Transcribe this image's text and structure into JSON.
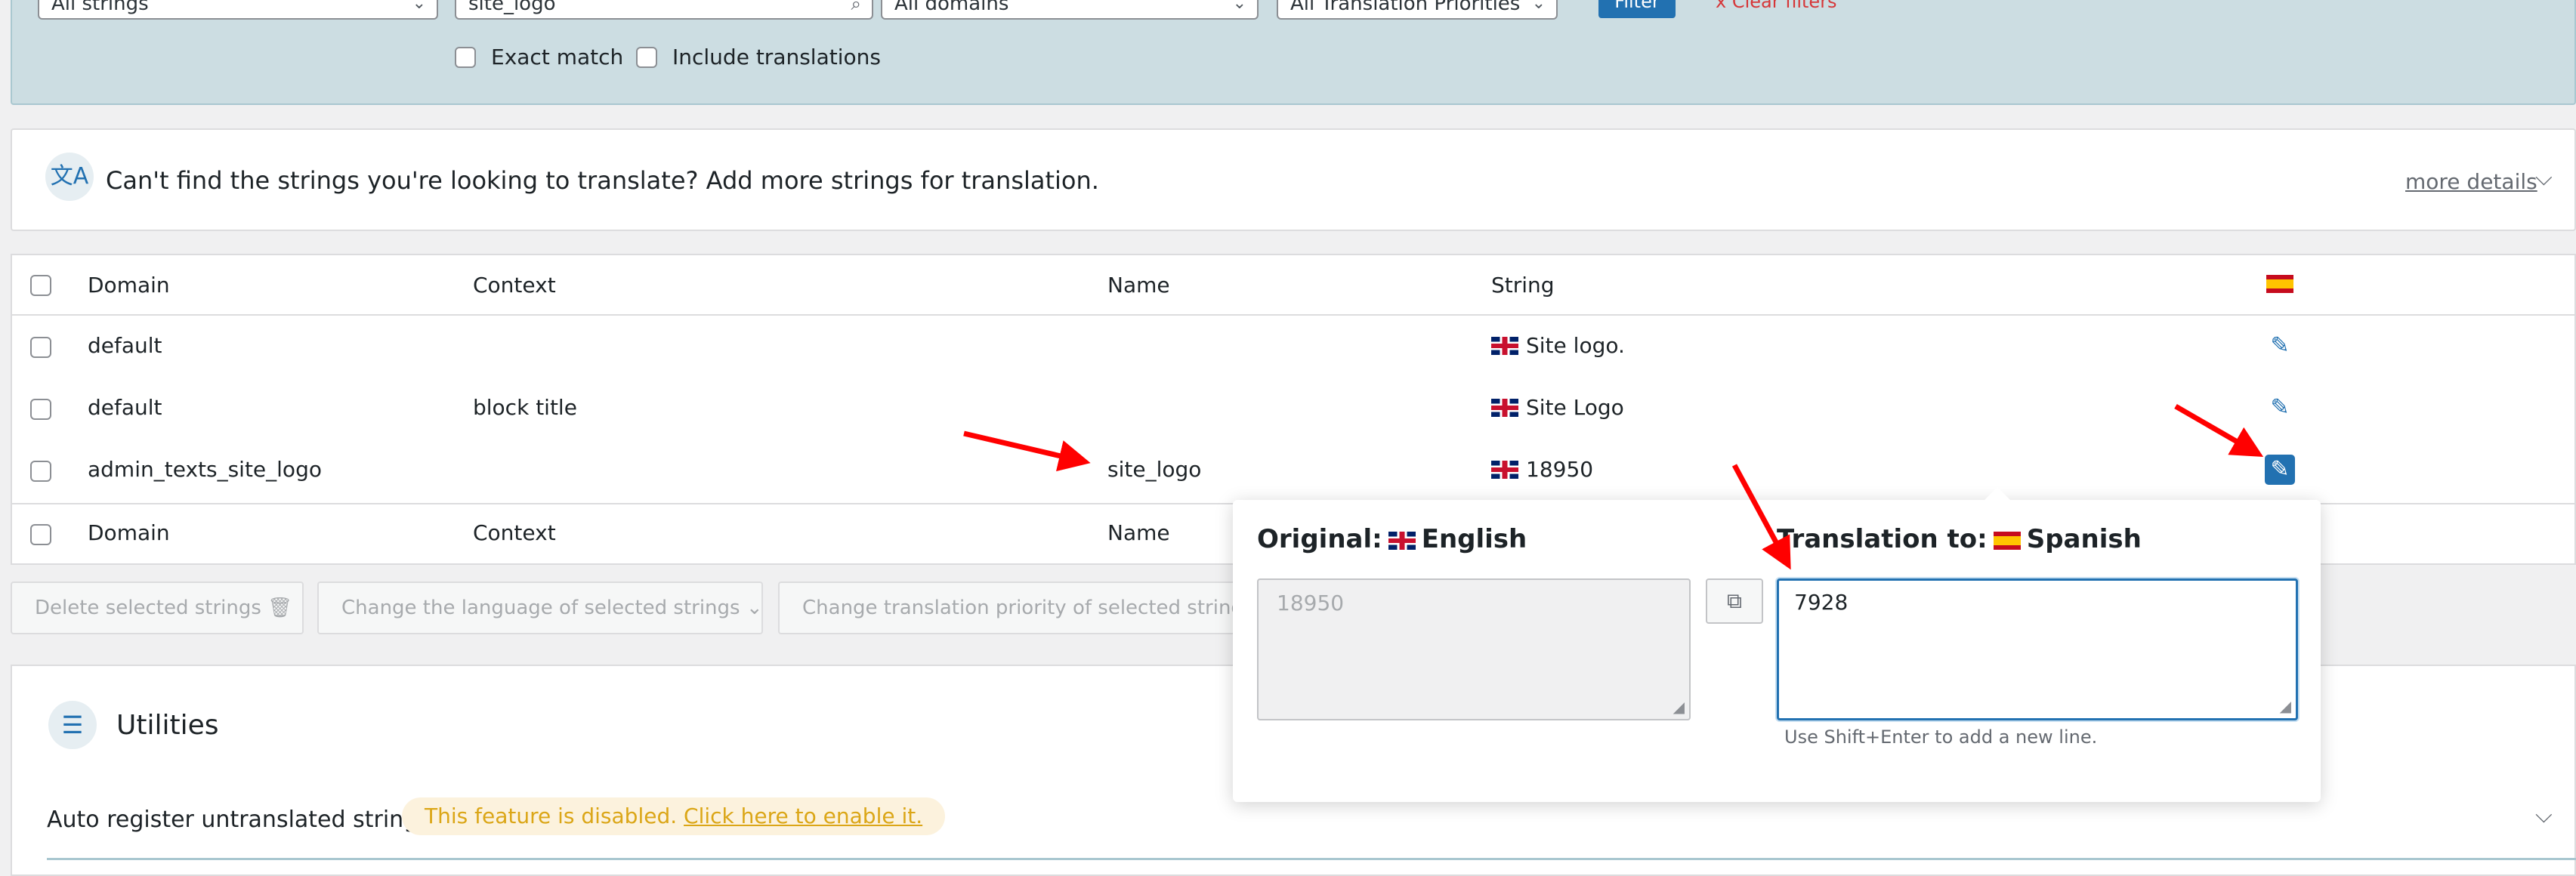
{
  "filters": {
    "strings_select": "All strings",
    "search_value": "site_logo",
    "domains_select": "All domains",
    "priorities_select": "All Translation Priorities",
    "filter_button": "Filter",
    "clear_filters": "x Clear filters",
    "exact_match": "Exact match",
    "include_translations": "Include translations"
  },
  "notice": {
    "text": "Can't find the strings you're looking to translate? Add more strings for translation.",
    "more_details": "more details"
  },
  "table": {
    "headers": {
      "domain": "Domain",
      "context": "Context",
      "name": "Name",
      "string": "String"
    },
    "rows": [
      {
        "domain": "default",
        "context": "",
        "name": "",
        "string": "Site logo."
      },
      {
        "domain": "default",
        "context": "block title",
        "name": "",
        "string": "Site Logo"
      },
      {
        "domain": "admin_texts_site_logo",
        "context": "",
        "name": "site_logo",
        "string": "18950"
      }
    ],
    "footers": {
      "domain": "Domain",
      "context": "Context",
      "name": "Name"
    }
  },
  "bulk_actions": {
    "delete": "Delete selected strings",
    "change_language": "Change the language of selected strings",
    "change_priority": "Change translation priority of selected strings"
  },
  "utilities": {
    "title": "Utilities",
    "auto_register_label": "Auto register untranslated strings",
    "disabled_text": "This feature is disabled.",
    "enable_link": "Click here to enable it."
  },
  "popup": {
    "original_label": "Original:",
    "original_language": "English",
    "translation_label": "Translation to:",
    "translation_language": "Spanish",
    "original_value": "18950",
    "translation_value": "7928",
    "hint": "Use Shift+Enter to add a new line."
  },
  "colors": {
    "accent": "#2271b1",
    "filterbar": "#ccdde2",
    "annotation_arrow": "#ff0000",
    "disabled_text": "#dba617"
  }
}
